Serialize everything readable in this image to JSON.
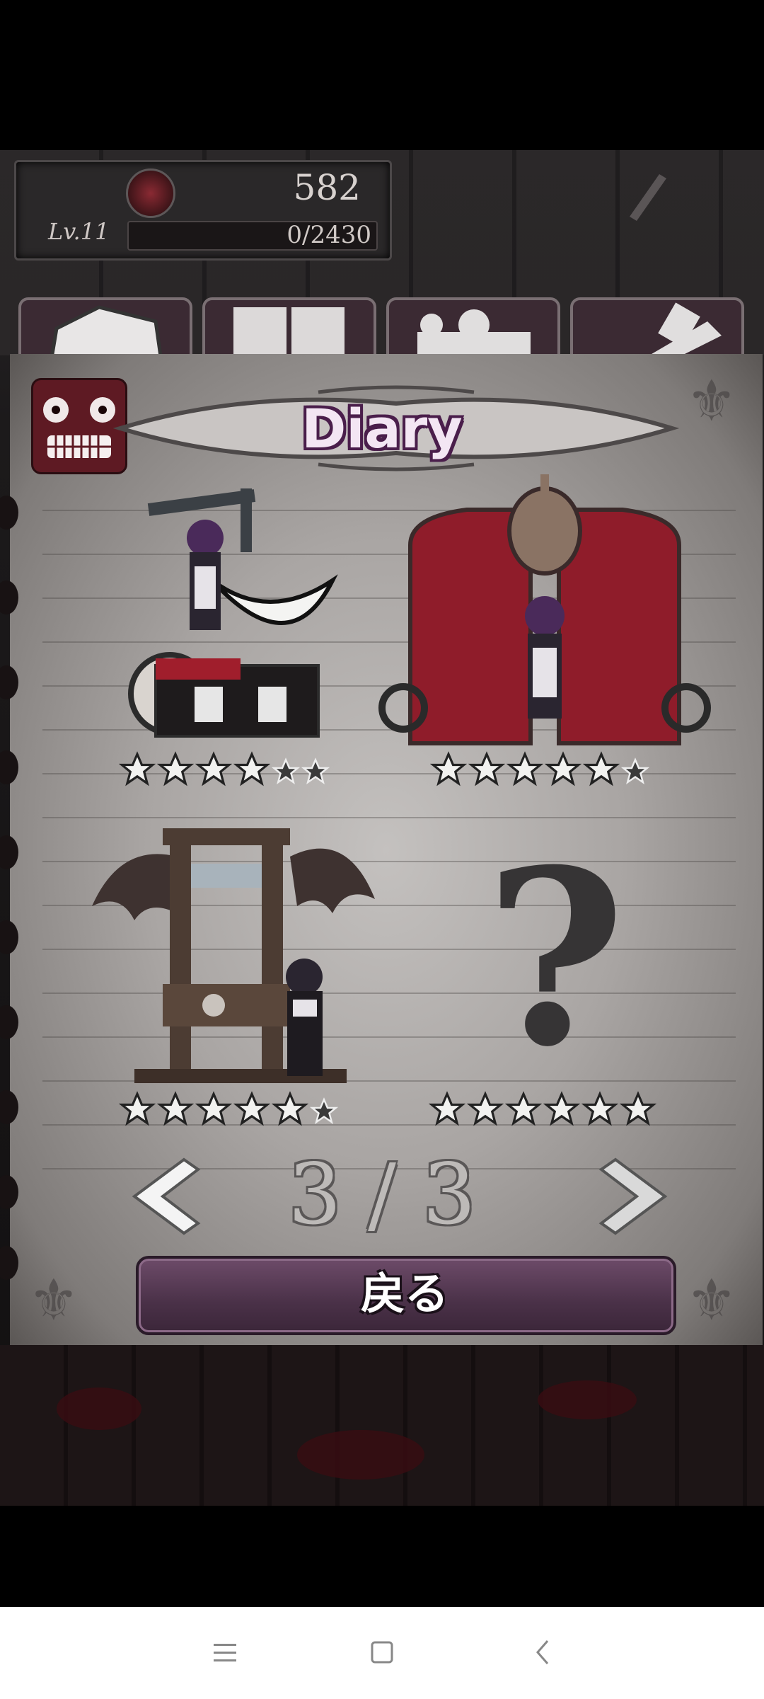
{
  "status": {
    "coins": "582",
    "level": "Lv.11",
    "exp": "0/2430"
  },
  "tabs": [
    {
      "icon": "gem-icon"
    },
    {
      "icon": "book-icon"
    },
    {
      "icon": "puzzle-icon"
    },
    {
      "icon": "wrench-icon"
    }
  ],
  "diary": {
    "title": "Diary",
    "cards": [
      {
        "name": "wheelchair-gallows-girl",
        "stars_filled": 4,
        "stars_total": 6
      },
      {
        "name": "iron-maiden-girl",
        "stars_filled": 5,
        "stars_total": 6
      },
      {
        "name": "guillotine-nun",
        "stars_filled": 5,
        "stars_total": 6
      },
      {
        "name": "locked-card",
        "stars_filled": 6,
        "stars_total": 6,
        "placeholder": "?"
      }
    ],
    "page_indicator": "3 / 3",
    "back_button": "戻る"
  },
  "colors": {
    "accent_purple": "#4a3148",
    "star_fill": "#f2f2f0",
    "paper": "#a9a5a3"
  },
  "system_nav": [
    {
      "icon": "menu-icon"
    },
    {
      "icon": "home-square-icon"
    },
    {
      "icon": "back-chevron-icon"
    }
  ]
}
